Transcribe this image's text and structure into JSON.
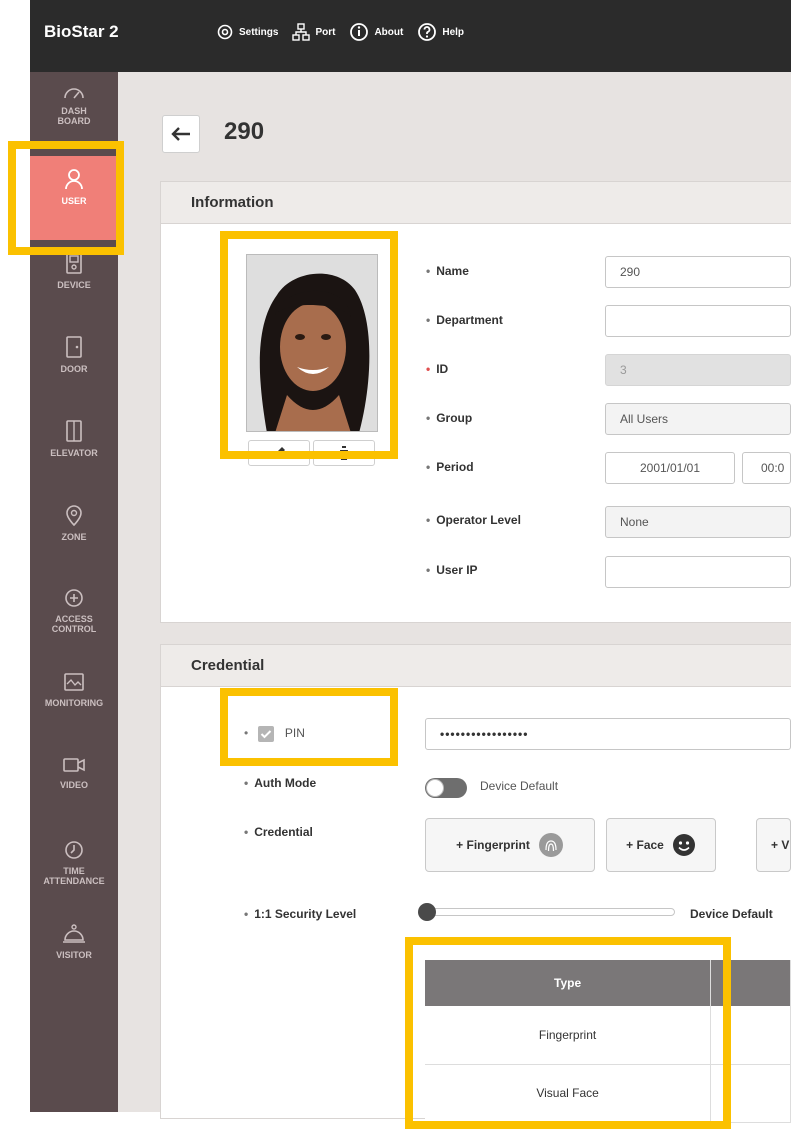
{
  "app": {
    "title": "BioStar 2"
  },
  "topnav": {
    "settings": "Settings",
    "port": "Port",
    "about": "About",
    "help": "Help"
  },
  "sidebar": {
    "items": [
      {
        "label": "DASH\nBOARD",
        "icon": "dashboard-icon"
      },
      {
        "label": "USER",
        "icon": "user-icon",
        "active": true
      },
      {
        "label": "DEVICE",
        "icon": "device-icon"
      },
      {
        "label": "DOOR",
        "icon": "door-icon"
      },
      {
        "label": "ELEVATOR",
        "icon": "elevator-icon"
      },
      {
        "label": "ZONE",
        "icon": "zone-icon"
      },
      {
        "label": "ACCESS\nCONTROL",
        "icon": "access-control-icon"
      },
      {
        "label": "MONITORING",
        "icon": "monitoring-icon"
      },
      {
        "label": "VIDEO",
        "icon": "video-icon"
      },
      {
        "label": "TIME\nATTENDANCE",
        "icon": "time-attendance-icon"
      },
      {
        "label": "VISITOR",
        "icon": "visitor-icon"
      }
    ]
  },
  "page": {
    "title": "290"
  },
  "information": {
    "header": "Information",
    "fields": {
      "name": {
        "label": "Name",
        "value": "290"
      },
      "department": {
        "label": "Department",
        "value": ""
      },
      "id": {
        "label": "ID",
        "value": "3"
      },
      "group": {
        "label": "Group",
        "value": "All Users"
      },
      "period": {
        "label": "Period",
        "start_date": "2001/01/01",
        "start_time": "00:0"
      },
      "operator_level": {
        "label": "Operator Level",
        "value": "None"
      },
      "user_ip": {
        "label": "User IP",
        "value": ""
      }
    }
  },
  "credential": {
    "header": "Credential",
    "pin": {
      "label": "PIN",
      "checked": true,
      "value": "•••••••••••••••••"
    },
    "auth_mode": {
      "label": "Auth Mode",
      "value": "Device Default"
    },
    "credential_label": "Credential",
    "buttons": {
      "fingerprint": "+ Fingerprint",
      "face": "+ Face",
      "visual_face": "+ V"
    },
    "security_level": {
      "label": "1:1 Security Level",
      "value": "Device Default"
    },
    "table": {
      "header": "Type",
      "rows": [
        "Fingerprint",
        "Visual Face"
      ]
    }
  },
  "colors": {
    "topbar": "#2b2b2b",
    "sidebar": "#5a4b4d",
    "active": "#f07f78",
    "highlight": "#fbc100",
    "background": "#e7e3e1"
  }
}
